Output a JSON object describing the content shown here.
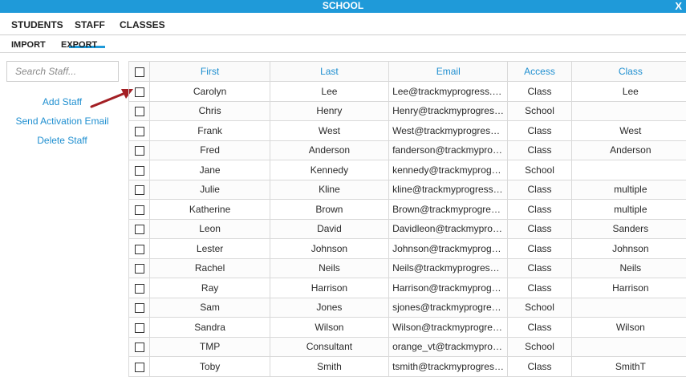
{
  "window": {
    "title": "SCHOOL",
    "close_label": "X"
  },
  "tabs": [
    {
      "label": "STUDENTS"
    },
    {
      "label": "STAFF",
      "active": true
    },
    {
      "label": "CLASSES"
    }
  ],
  "subbar": {
    "import_label": "IMPORT",
    "export_label": "EXPORT"
  },
  "search": {
    "placeholder": "Search Staff..."
  },
  "actions": {
    "add": "Add Staff",
    "send": "Send Activation Email",
    "delete": "Delete Staff"
  },
  "colors": {
    "accent": "#1f9ad9",
    "link": "#1f8fd0",
    "arrow": "#a31f24"
  },
  "table": {
    "columns": [
      "First",
      "Last",
      "Email",
      "Access",
      "Class"
    ],
    "rows": [
      {
        "first": "Carolyn",
        "last": "Lee",
        "email": "Lee@trackmyprogress.com",
        "access": "Class",
        "class": "Lee"
      },
      {
        "first": "Chris",
        "last": "Henry",
        "email": "Henry@trackmyprogress....",
        "access": "School",
        "class": ""
      },
      {
        "first": "Frank",
        "last": "West",
        "email": "West@trackmyprogress.c...",
        "access": "Class",
        "class": "West"
      },
      {
        "first": "Fred",
        "last": "Anderson",
        "email": "fanderson@trackmyprogr...",
        "access": "Class",
        "class": "Anderson"
      },
      {
        "first": "Jane",
        "last": "Kennedy",
        "email": "kennedy@trackmyprogres...",
        "access": "School",
        "class": ""
      },
      {
        "first": "Julie",
        "last": "Kline",
        "email": "kline@trackmyprogress.c...",
        "access": "Class",
        "class": "multiple"
      },
      {
        "first": "Katherine",
        "last": "Brown",
        "email": "Brown@trackmyprogress....",
        "access": "Class",
        "class": "multiple"
      },
      {
        "first": "Leon",
        "last": "David",
        "email": "Davidleon@trackmyprogr...",
        "access": "Class",
        "class": "Sanders"
      },
      {
        "first": "Lester",
        "last": "Johnson",
        "email": "Johnson@trackmyprogres...",
        "access": "Class",
        "class": "Johnson"
      },
      {
        "first": "Rachel",
        "last": "Neils",
        "email": "Neils@trackmyprogress.c...",
        "access": "Class",
        "class": "Neils"
      },
      {
        "first": "Ray",
        "last": "Harrison",
        "email": "Harrison@trackmyprogres...",
        "access": "Class",
        "class": "Harrison"
      },
      {
        "first": "Sam",
        "last": "Jones",
        "email": "sjones@trackmyprogress....",
        "access": "School",
        "class": ""
      },
      {
        "first": "Sandra",
        "last": "Wilson",
        "email": "Wilson@trackmyprogress....",
        "access": "Class",
        "class": "Wilson"
      },
      {
        "first": "TMP",
        "last": "Consultant",
        "email": "orange_vt@trackmyprogre...",
        "access": "School",
        "class": ""
      },
      {
        "first": "Toby",
        "last": "Smith",
        "email": "tsmith@trackmyprogress....",
        "access": "Class",
        "class": "SmithT"
      }
    ]
  }
}
